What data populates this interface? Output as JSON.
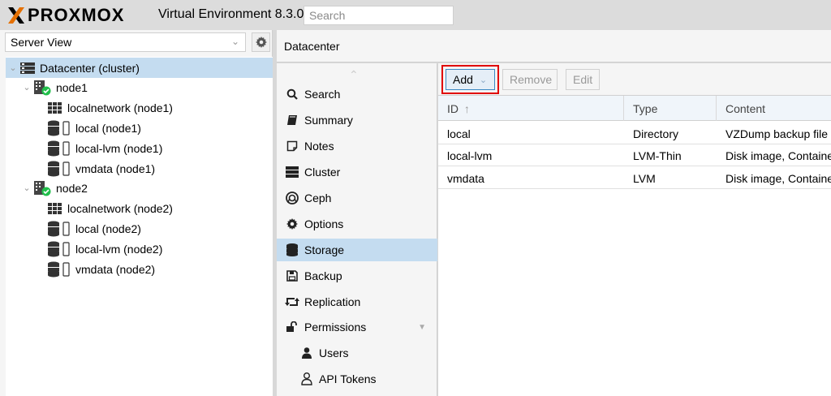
{
  "topbar": {
    "logo_text": "PROXMOX",
    "version": "Virtual Environment 8.3.0",
    "search_placeholder": "Search"
  },
  "left": {
    "view_select": "Server View",
    "tree": [
      {
        "label": "Datacenter (cluster)",
        "icon": "datacenter-icon"
      },
      {
        "label": "node1",
        "icon": "node-online-icon"
      },
      {
        "label": "localnetwork (node1)",
        "icon": "network-grid-icon"
      },
      {
        "label": "local (node1)",
        "icon": "storage-icon"
      },
      {
        "label": "local-lvm (node1)",
        "icon": "storage-icon"
      },
      {
        "label": "vmdata (node1)",
        "icon": "storage-icon"
      },
      {
        "label": "node2",
        "icon": "node-online-icon"
      },
      {
        "label": "localnetwork (node2)",
        "icon": "network-grid-icon"
      },
      {
        "label": "local (node2)",
        "icon": "storage-icon"
      },
      {
        "label": "local-lvm (node2)",
        "icon": "storage-icon"
      },
      {
        "label": "vmdata (node2)",
        "icon": "storage-icon"
      }
    ]
  },
  "header": {
    "title": "Datacenter"
  },
  "menu": {
    "items": [
      {
        "label": "Search",
        "icon": "search-icon"
      },
      {
        "label": "Summary",
        "icon": "book-icon"
      },
      {
        "label": "Notes",
        "icon": "notes-icon"
      },
      {
        "label": "Cluster",
        "icon": "server-icon"
      },
      {
        "label": "Ceph",
        "icon": "ceph-icon"
      },
      {
        "label": "Options",
        "icon": "gear-icon"
      },
      {
        "label": "Storage",
        "icon": "database-icon"
      },
      {
        "label": "Backup",
        "icon": "floppy-icon"
      },
      {
        "label": "Replication",
        "icon": "retweet-icon"
      },
      {
        "label": "Permissions",
        "icon": "unlock-icon"
      },
      {
        "label": "Users",
        "icon": "user-icon"
      },
      {
        "label": "API Tokens",
        "icon": "user-outline-icon"
      }
    ]
  },
  "toolbar": {
    "add": "Add",
    "remove": "Remove",
    "edit": "Edit"
  },
  "grid": {
    "columns": [
      "ID",
      "Type",
      "Content"
    ],
    "rows": [
      {
        "id": "local",
        "type": "Directory",
        "content": "VZDump backup file"
      },
      {
        "id": "local-lvm",
        "type": "LVM-Thin",
        "content": "Disk image, Container"
      },
      {
        "id": "vmdata",
        "type": "LVM",
        "content": "Disk image, Container"
      }
    ]
  },
  "colors": {
    "selection": "#c4dcf0",
    "highlight": "#e00000",
    "accent": "#3b88c3",
    "logo_orange": "#e57000"
  }
}
